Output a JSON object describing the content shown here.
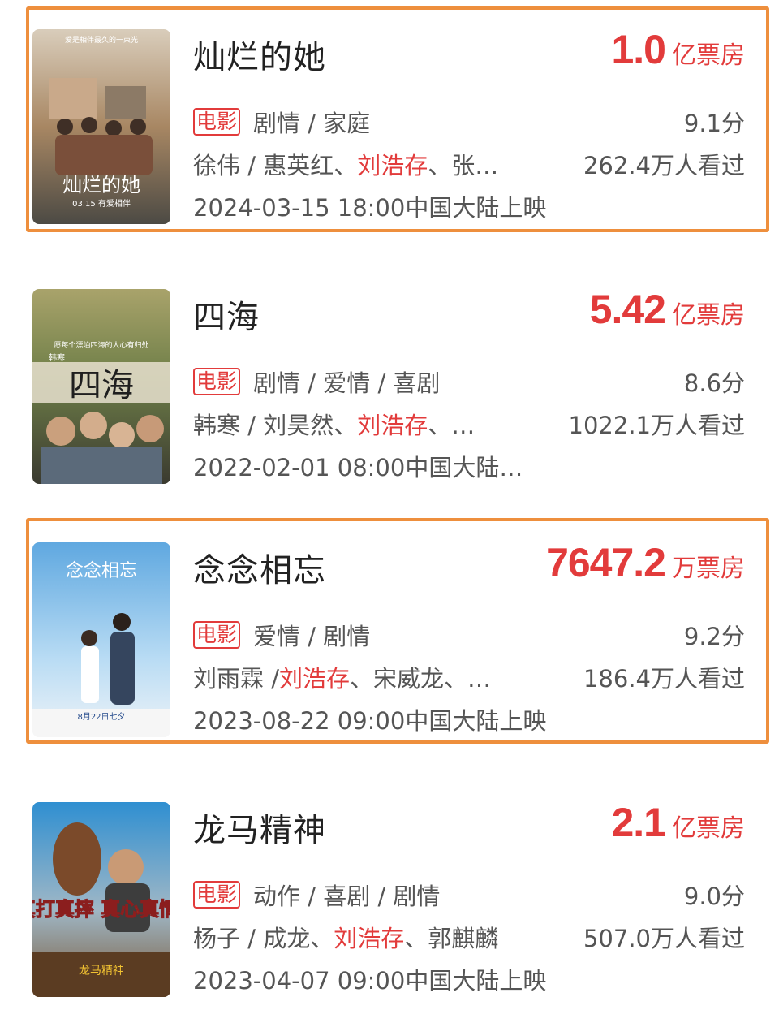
{
  "movies": [
    {
      "title": "灿烂的她",
      "highlighted": true,
      "boxoffice_value": "1.0",
      "boxoffice_unit": "亿票房",
      "badge": "电影",
      "genres": "剧情 / 家庭",
      "rating": "9.1分",
      "cast_prefix": "徐伟 / 惠英红、",
      "cast_highlight": "刘浩存",
      "cast_suffix": "、张…",
      "viewers": "262.4万人看过",
      "release": "2024-03-15 18:00中国大陆上映",
      "poster_text": "灿烂的她",
      "poster_subtext": "03.15 有爱相伴",
      "poster_tagline": "爱是相伴最久的一束光",
      "poster_colors": [
        "#b98c63",
        "#6f8a95"
      ]
    },
    {
      "title": "四海",
      "highlighted": false,
      "boxoffice_value": "5.42",
      "boxoffice_unit": "亿票房",
      "badge": "电影",
      "genres": "剧情 / 爱情 / 喜剧",
      "rating": "8.6分",
      "cast_prefix": "韩寒 / 刘昊然、",
      "cast_highlight": "刘浩存",
      "cast_suffix": "、…",
      "viewers": "1022.1万人看过",
      "release": "2022-02-01 08:00中国大陆…",
      "poster_text": "四海",
      "poster_subtext": "韩寒",
      "poster_tagline": "愿每个漂泊四海的人心有归处",
      "poster_colors": [
        "#6b7f4b",
        "#c9b27a"
      ]
    },
    {
      "title": "念念相忘",
      "highlighted": true,
      "boxoffice_value": "7647.2",
      "boxoffice_unit": "万票房",
      "badge": "电影",
      "genres": "爱情 / 剧情",
      "rating": "9.2分",
      "cast_prefix": "刘雨霖 / ",
      "cast_highlight": "刘浩存",
      "cast_suffix": "、宋威龙、…",
      "viewers": "186.4万人看过",
      "release": "2023-08-22 09:00中国大陆上映",
      "poster_text": "念念相忘",
      "poster_subtext": "8月22日七夕",
      "poster_tagline": "",
      "poster_colors": [
        "#8ec3ea",
        "#f2f5f8"
      ]
    },
    {
      "title": "龙马精神",
      "highlighted": false,
      "boxoffice_value": "2.1",
      "boxoffice_unit": "亿票房",
      "badge": "电影",
      "genres": "动作 / 喜剧 / 剧情",
      "rating": "9.0分",
      "cast_prefix": "杨子 / 成龙、",
      "cast_highlight": "刘浩存",
      "cast_suffix": "、郭麒麟",
      "viewers": "507.0万人看过",
      "release": "2023-04-07 09:00中国大陆上映",
      "poster_text": "真打真摔 真心真情",
      "poster_subtext": "龙马精神",
      "poster_tagline": "",
      "poster_colors": [
        "#2d86c8",
        "#c7a86a"
      ]
    }
  ]
}
